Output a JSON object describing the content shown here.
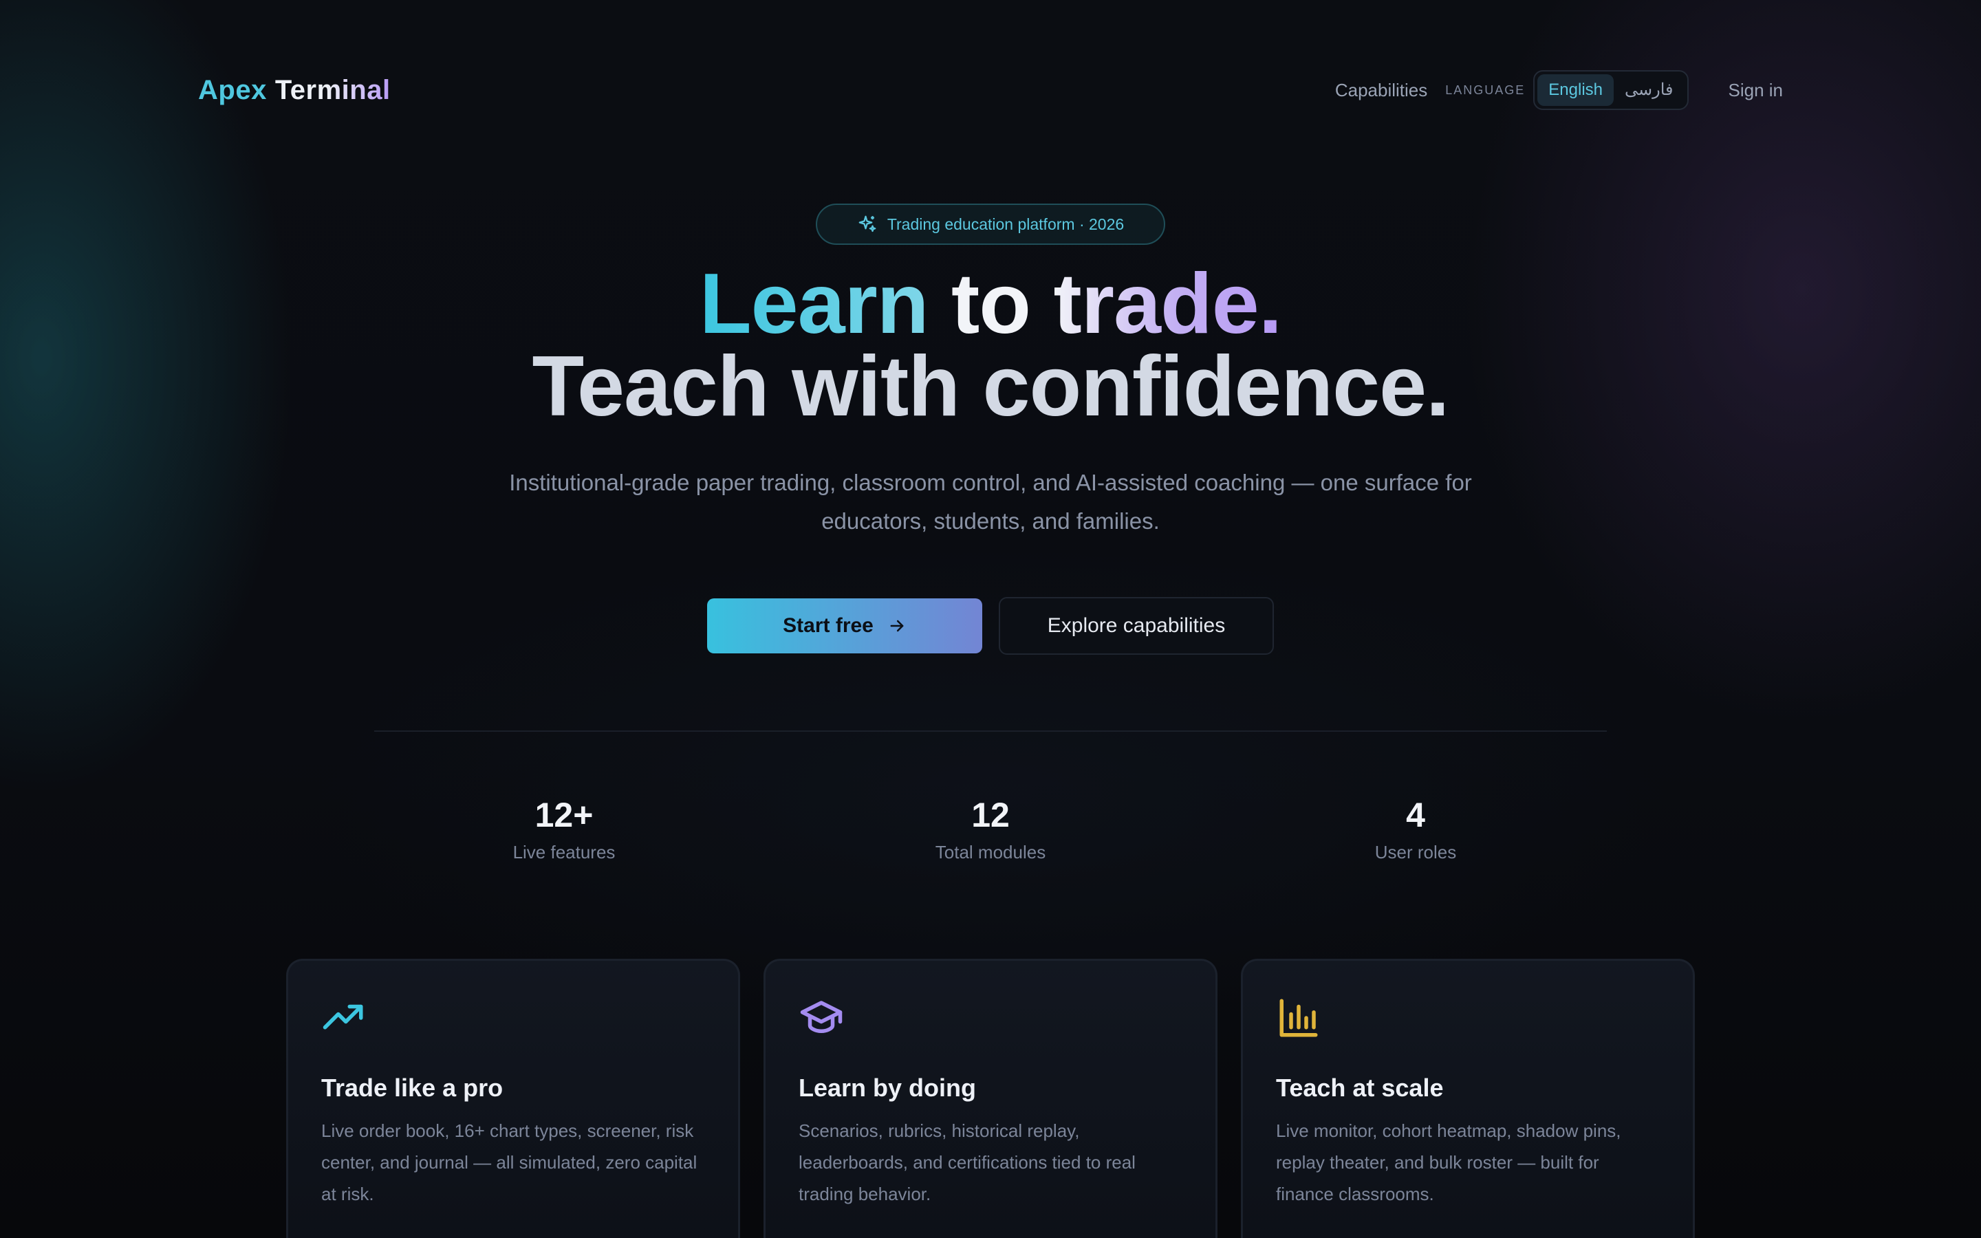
{
  "brand": {
    "part1": "Apex",
    "part2": "Terminal"
  },
  "nav": {
    "capabilities": "Capabilities",
    "language_label": "LANGUAGE",
    "languages": [
      "English",
      "فارسی"
    ],
    "active_language": "English",
    "sign_in": "Sign in"
  },
  "hero": {
    "badge": "Trading education platform · 2026",
    "headline_word1": "Learn",
    "headline_rest1": " to trade.",
    "headline_line2": "Teach with confidence.",
    "subtitle": "Institutional-grade paper trading, classroom control, and AI-assisted coaching — one surface for educators, students, and families.",
    "cta_primary": "Start free",
    "cta_secondary": "Explore capabilities"
  },
  "stats": [
    {
      "value": "12+",
      "label": "Live features"
    },
    {
      "value": "12",
      "label": "Total modules"
    },
    {
      "value": "4",
      "label": "User roles"
    }
  ],
  "cards": [
    {
      "icon": "trending-up-icon",
      "title": "Trade like a pro",
      "desc": "Live order book, 16+ chart types, screener, risk center, and journal — all simulated, zero capital at risk."
    },
    {
      "icon": "graduation-cap-icon",
      "title": "Learn by doing",
      "desc": "Scenarios, rubrics, historical replay, leaderboards, and certifications tied to real trading behavior."
    },
    {
      "icon": "bar-chart-icon",
      "title": "Teach at scale",
      "desc": "Live monitor, cohort heatmap, shadow pins, replay theater, and bulk roster — built for finance classrooms."
    }
  ],
  "colors": {
    "accent_cyan": "#3cc6e0",
    "accent_purple": "#b79af5",
    "accent_amber": "#e0b43a",
    "background": "#0a0c11"
  }
}
